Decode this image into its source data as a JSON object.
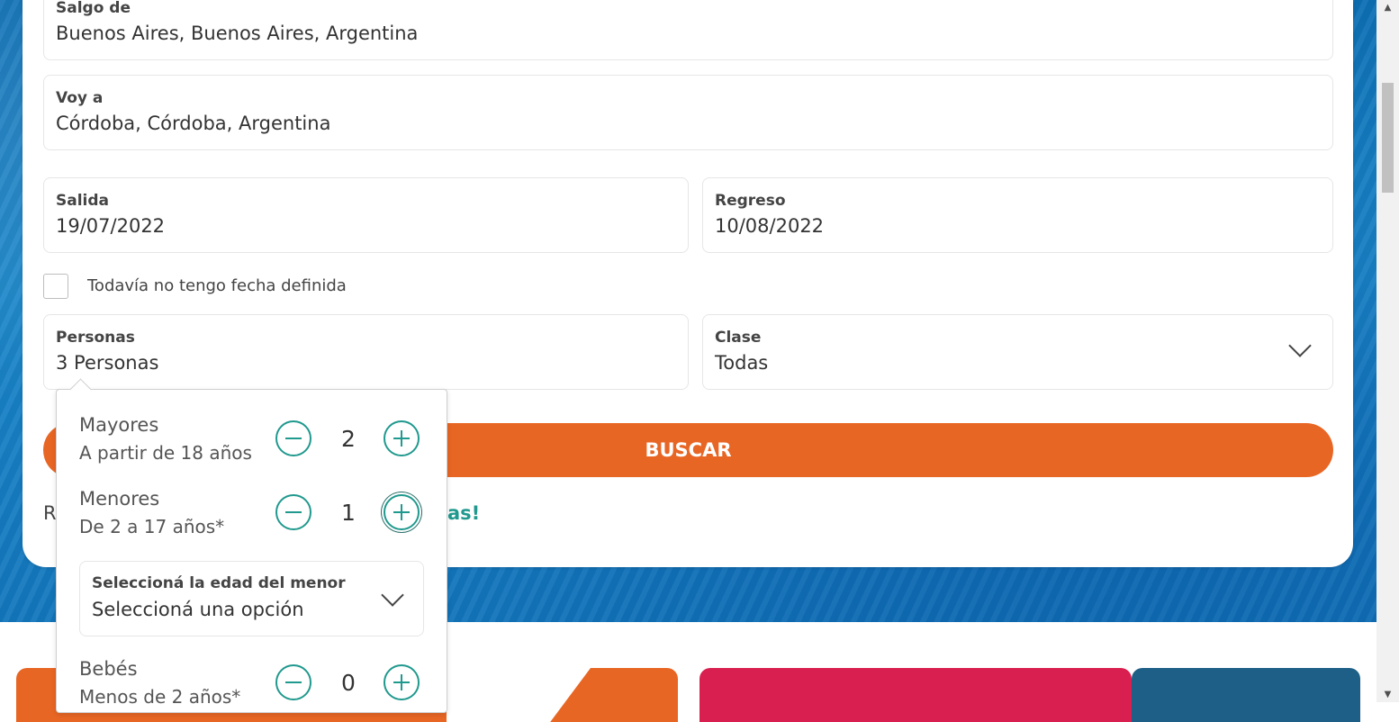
{
  "form": {
    "origin": {
      "label": "Salgo de",
      "value": "Buenos Aires, Buenos Aires, Argentina"
    },
    "destination": {
      "label": "Voy a",
      "value": "Córdoba, Córdoba, Argentina"
    },
    "departure": {
      "label": "Salida",
      "value": "19/07/2022"
    },
    "return": {
      "label": "Regreso",
      "value": "10/08/2022"
    },
    "no_date_label": "Todavía no tengo fecha definida",
    "persons": {
      "label": "Personas",
      "value": "3 Personas"
    },
    "class": {
      "label": "Clase",
      "value": "Todas"
    },
    "search_label": "BUSCAR",
    "promo_prefix": "R",
    "promo_suffix": "as!"
  },
  "passengers": {
    "adults": {
      "title": "Mayores",
      "subtitle": "A partir de 18 años",
      "count": "2"
    },
    "minors": {
      "title": "Menores",
      "subtitle": "De 2 a 17 años*",
      "count": "1"
    },
    "minor_age": {
      "label": "Seleccioná la edad del menor",
      "value": "Seleccioná una opción"
    },
    "infants": {
      "title": "Bebés",
      "subtitle": "Menos de 2 años*",
      "count": "0"
    }
  },
  "colors": {
    "accent": "#e86624",
    "teal": "#20998e",
    "promo_red": "#d81f4f",
    "promo_blue": "#1d5f86"
  }
}
